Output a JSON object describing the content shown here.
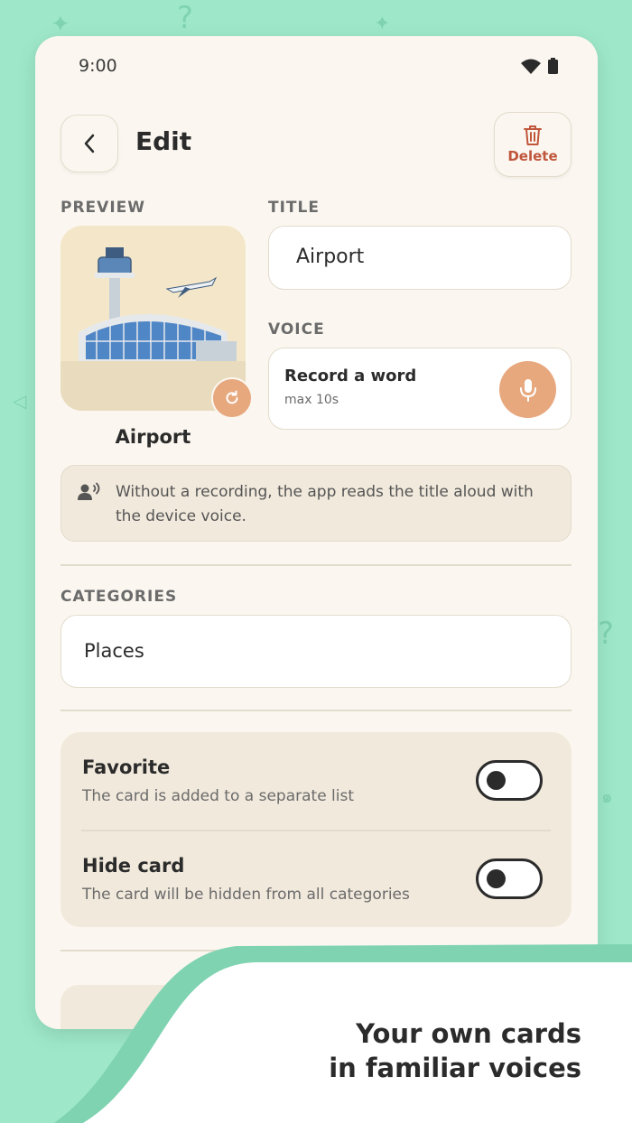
{
  "status_bar": {
    "time": "9:00"
  },
  "header": {
    "title": "Edit",
    "delete_label": "Delete"
  },
  "preview": {
    "label": "PREVIEW",
    "caption": "Airport"
  },
  "title_field": {
    "label": "TITLE",
    "value": "Airport"
  },
  "voice": {
    "label": "VOICE",
    "title": "Record a word",
    "subtitle": "max 10s"
  },
  "info": {
    "text": "Without a recording, the app reads the title aloud with the device voice."
  },
  "categories": {
    "label": "CATEGORIES",
    "value": "Places"
  },
  "toggles": [
    {
      "title": "Favorite",
      "subtitle": "The card is added to a separate list",
      "on": false
    },
    {
      "title": "Hide card",
      "subtitle": "The card will be hidden from all categories",
      "on": false
    }
  ],
  "tagline": {
    "line1": "Your own cards",
    "line2": "in familiar voices"
  },
  "colors": {
    "background": "#9ee8c9",
    "accent": "#e7a87e",
    "danger": "#c0563c",
    "card": "#fbf7f0"
  }
}
